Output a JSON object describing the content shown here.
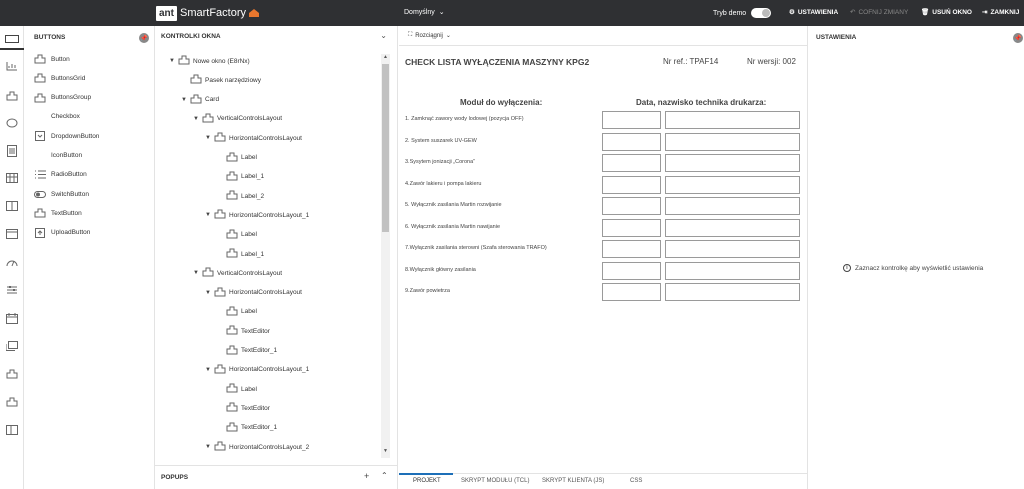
{
  "app": {
    "logo_ant": "ant",
    "logo_name": "SmartFactory",
    "environment": "Domyślny",
    "demo_label": "Tryb demo",
    "actions": {
      "settings": "USTAWIENIA",
      "undo": "COFNIJ ZMIANY",
      "delete_window": "USUŃ OKNO",
      "close": "ZAMKNIJ"
    }
  },
  "buttons_panel": {
    "title": "BUTTONS",
    "items": [
      {
        "label": "Button",
        "icon": "component-icon"
      },
      {
        "label": "ButtonsGrid",
        "icon": "component-icon"
      },
      {
        "label": "ButtonsGroup",
        "icon": "component-icon"
      },
      {
        "label": "Checkbox",
        "icon": "none"
      },
      {
        "label": "DropdownButton",
        "icon": "dropdown-icon"
      },
      {
        "label": "IconButton",
        "icon": "none"
      },
      {
        "label": "RadioButton",
        "icon": "list-icon"
      },
      {
        "label": "SwitchButton",
        "icon": "switch-icon"
      },
      {
        "label": "TextButton",
        "icon": "component-icon"
      },
      {
        "label": "UploadButton",
        "icon": "upload-icon"
      }
    ]
  },
  "tree_panel": {
    "title": "KONTROLKI OKNA",
    "nodes": [
      {
        "label": "Nowe okno (E8rNx)",
        "caret": "▼"
      },
      {
        "label": "Pasek narzędziowy",
        "caret": ""
      },
      {
        "label": "Card",
        "caret": "▼"
      },
      {
        "label": "VerticalControlsLayout",
        "caret": "▼"
      },
      {
        "label": "HorizontalControlsLayout",
        "caret": "▼"
      },
      {
        "label": "Label",
        "caret": ""
      },
      {
        "label": "Label_1",
        "caret": ""
      },
      {
        "label": "Label_2",
        "caret": ""
      },
      {
        "label": "HorizontalControlsLayout_1",
        "caret": "▼"
      },
      {
        "label": "Label",
        "caret": ""
      },
      {
        "label": "Label_1",
        "caret": ""
      },
      {
        "label": "VerticalControlsLayout",
        "caret": "▼"
      },
      {
        "label": "HorizontalControlsLayout",
        "caret": "▼"
      },
      {
        "label": "Label",
        "caret": ""
      },
      {
        "label": "TextEditor",
        "caret": ""
      },
      {
        "label": "TextEditor_1",
        "caret": ""
      },
      {
        "label": "HorizontalControlsLayout_1",
        "caret": "▼"
      },
      {
        "label": "Label",
        "caret": ""
      },
      {
        "label": "TextEditor",
        "caret": ""
      },
      {
        "label": "TextEditor_1",
        "caret": ""
      },
      {
        "label": "HorizontalControlsLayout_2",
        "caret": "▼"
      }
    ],
    "popups_title": "POPUPS"
  },
  "canvas": {
    "stretch_label": "Rozciągnij",
    "doc_title": "CHECK LISTA WYŁĄCZENIA MASZYNY KPG2",
    "ref": "Nr ref.: TPAF14",
    "version": "Nr wersji: 002",
    "col_module": "Moduł do wyłączenia:",
    "col_tech": "Data, nazwisko technika drukarza:",
    "rows": [
      "1. Zamknąć zawory wody lodowej (pozycja OFF)",
      "2. System suszarek UV-GEW",
      "3.Sysytem jonizacji „Corona”",
      "4.Zawór lakieru i pompa lakieru",
      "5. Wyłącznik zasilania Martin rozwijanie",
      "6. Wyłącznik zasilania Martin nawijanie",
      "7.Wyłącznik zasilania sterowni (Szafa sterowania TRAFO)",
      "8.Wyłącznik główny zasilania",
      "9.Zawór powietrza"
    ],
    "tabs": [
      "PROJEKT",
      "SKRYPT MODUŁU (TCL)",
      "SKRYPT KLIENTA (JS)",
      "CSS"
    ]
  },
  "settings_panel": {
    "title": "USTAWIENIA",
    "hint": "Zaznacz kontrolkę aby wyświetlić ustawienia"
  }
}
